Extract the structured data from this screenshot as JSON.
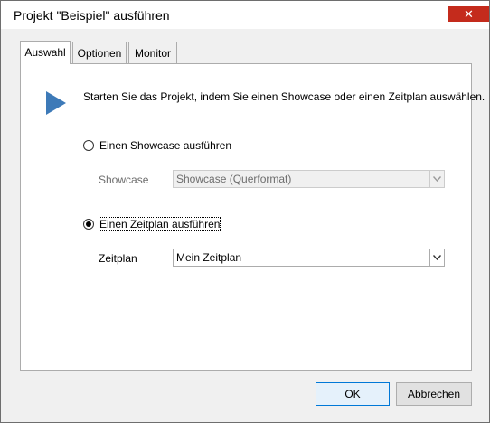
{
  "window": {
    "title": "Projekt \"Beispiel\" ausführen",
    "close_glyph": "✕"
  },
  "tabs": [
    {
      "label": "Auswahl",
      "active": true
    },
    {
      "label": "Optionen",
      "active": false
    },
    {
      "label": "Monitor",
      "active": false
    }
  ],
  "panel": {
    "intro": "Starten Sie das Projekt, indem Sie einen Showcase oder einen Zeitplan auswählen.",
    "icon": "play-icon",
    "showcase_option": {
      "label": "Einen Showcase ausführen",
      "selected": false
    },
    "showcase_field": {
      "label": "Showcase",
      "value": "Showcase (Querformat)",
      "enabled": false
    },
    "schedule_option": {
      "label": "Einen Zeitplan ausführen",
      "selected": true
    },
    "schedule_field": {
      "label": "Zeitplan",
      "value": "Mein Zeitplan",
      "enabled": true
    }
  },
  "buttons": {
    "ok": "OK",
    "cancel": "Abbrechen"
  },
  "colors": {
    "accent": "#0078d7",
    "play_icon": "#3d7ab8",
    "close_button": "#c42b1c"
  }
}
